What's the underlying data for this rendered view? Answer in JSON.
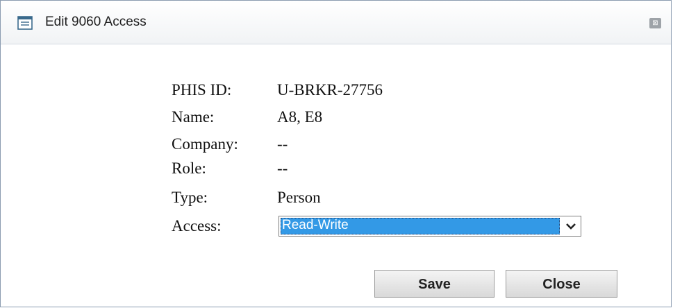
{
  "dialog": {
    "title": "Edit 9060 Access",
    "close_glyph": "⊠"
  },
  "fields": [
    {
      "label": "PHIS ID:",
      "value": "U-BRKR-27756"
    },
    {
      "label": "Name:",
      "value": "A8, E8"
    },
    {
      "label": "Company:",
      "value": "--"
    },
    {
      "label": "Role:",
      "value": "--"
    },
    {
      "label": "Type:",
      "value": "Person"
    }
  ],
  "access": {
    "label": "Access:",
    "selected": "Read-Write"
  },
  "buttons": {
    "save": "Save",
    "close": "Close"
  },
  "colors": {
    "selection": "#3399e6"
  }
}
